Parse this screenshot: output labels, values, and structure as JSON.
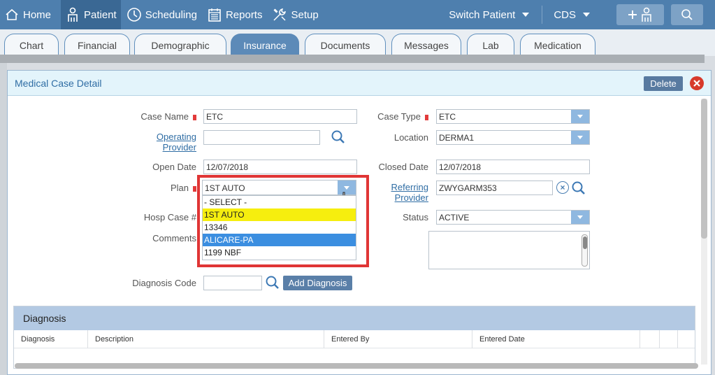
{
  "nav": {
    "home": "Home",
    "patient": "Patient",
    "scheduling": "Scheduling",
    "reports": "Reports",
    "setup": "Setup",
    "switch_patient": "Switch Patient",
    "cds": "CDS"
  },
  "tabs": [
    "Chart",
    "Financial",
    "Demographic",
    "Insurance",
    "Documents",
    "Messages",
    "Lab",
    "Medication"
  ],
  "active_tab": "Insurance",
  "dialog": {
    "title": "Medical Case Detail",
    "delete_label": "Delete"
  },
  "form": {
    "case_name_label": "Case Name",
    "case_name_value": "ETC",
    "case_type_label": "Case Type",
    "case_type_value": "ETC",
    "operating_provider_label_1": "Operating",
    "operating_provider_label_2": "Provider",
    "operating_provider_value": "",
    "location_label": "Location",
    "location_value": "DERMA1",
    "open_date_label": "Open Date",
    "open_date_value": "12/07/2018",
    "closed_date_label": "Closed Date",
    "closed_date_value": "12/07/2018",
    "plan_label": "Plan",
    "plan_value": "1ST AUTO",
    "referring_provider_label_1": "Referring",
    "referring_provider_label_2": "Provider",
    "referring_provider_value": "ZWYGARM353",
    "hosp_case_label": "Hosp Case #",
    "status_label": "Status",
    "status_value": "ACTIVE",
    "comments_label": "Comments",
    "diagnosis_code_label": "Diagnosis Code",
    "diagnosis_code_value": "",
    "add_diagnosis_label": "Add Diagnosis"
  },
  "plan_options": [
    "- SELECT -",
    "1ST AUTO",
    "13346",
    "ALICARE-PA",
    "1199 NBF"
  ],
  "diagnosis": {
    "title": "Diagnosis",
    "columns": [
      "Diagnosis",
      "Description",
      "Entered By",
      "Entered Date"
    ]
  },
  "colors": {
    "nav_bg": "#4e7fae",
    "highlight_yellow": "#f6ee0e",
    "highlight_blue": "#3b8ee0",
    "frame_red": "#e03535"
  }
}
